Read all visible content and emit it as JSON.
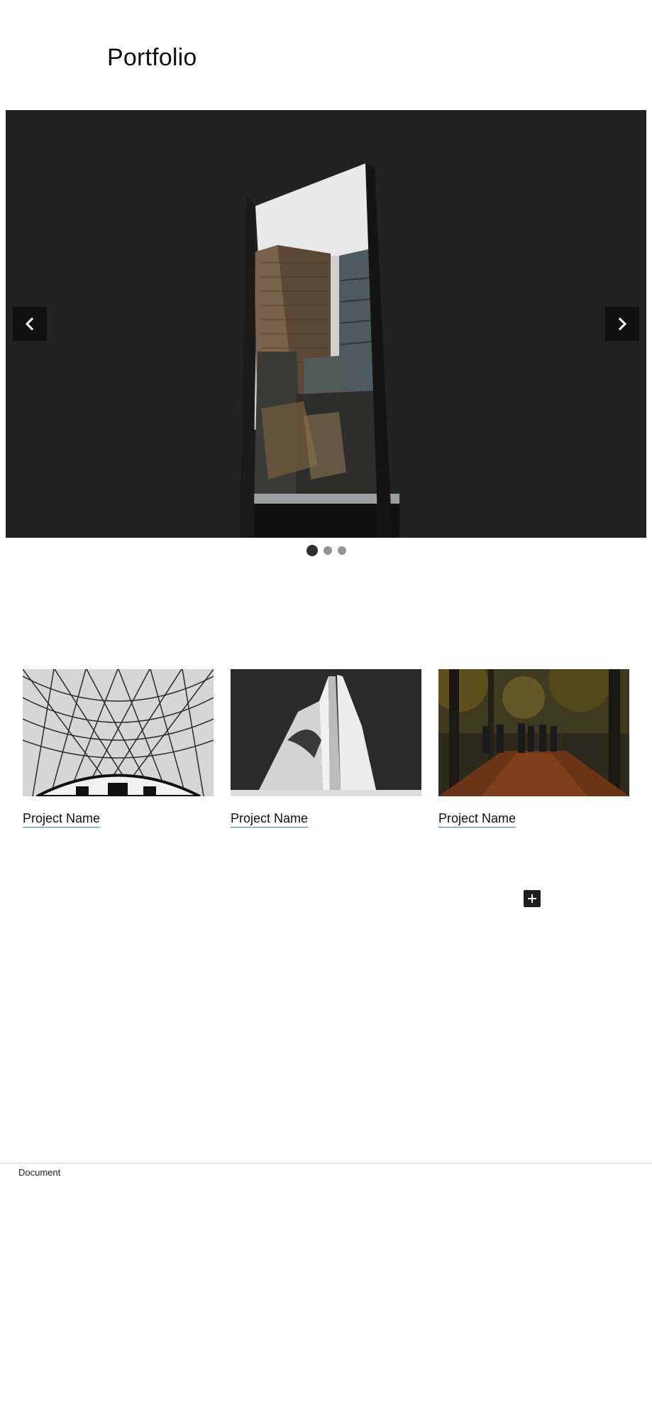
{
  "page": {
    "title": "Portfolio"
  },
  "slideshow": {
    "prev_icon": "chevron-left-icon",
    "next_icon": "chevron-right-icon",
    "slide_count": 3,
    "active_slide": 1
  },
  "projects": [
    {
      "name": "Project Name",
      "image": "glass-dome-roof-image"
    },
    {
      "name": "Project Name",
      "image": "white-concrete-building-image"
    },
    {
      "name": "Project Name",
      "image": "autumn-forest-walkers-image"
    }
  ],
  "editor": {
    "add_block_icon": "plus-icon"
  },
  "footer": {
    "breadcrumb": "Document"
  },
  "colors": {
    "slideshow_bg": "#222222",
    "link_underline": "#3582c4",
    "dot_active": "#2f2f2f",
    "dot_inactive": "#949494"
  }
}
